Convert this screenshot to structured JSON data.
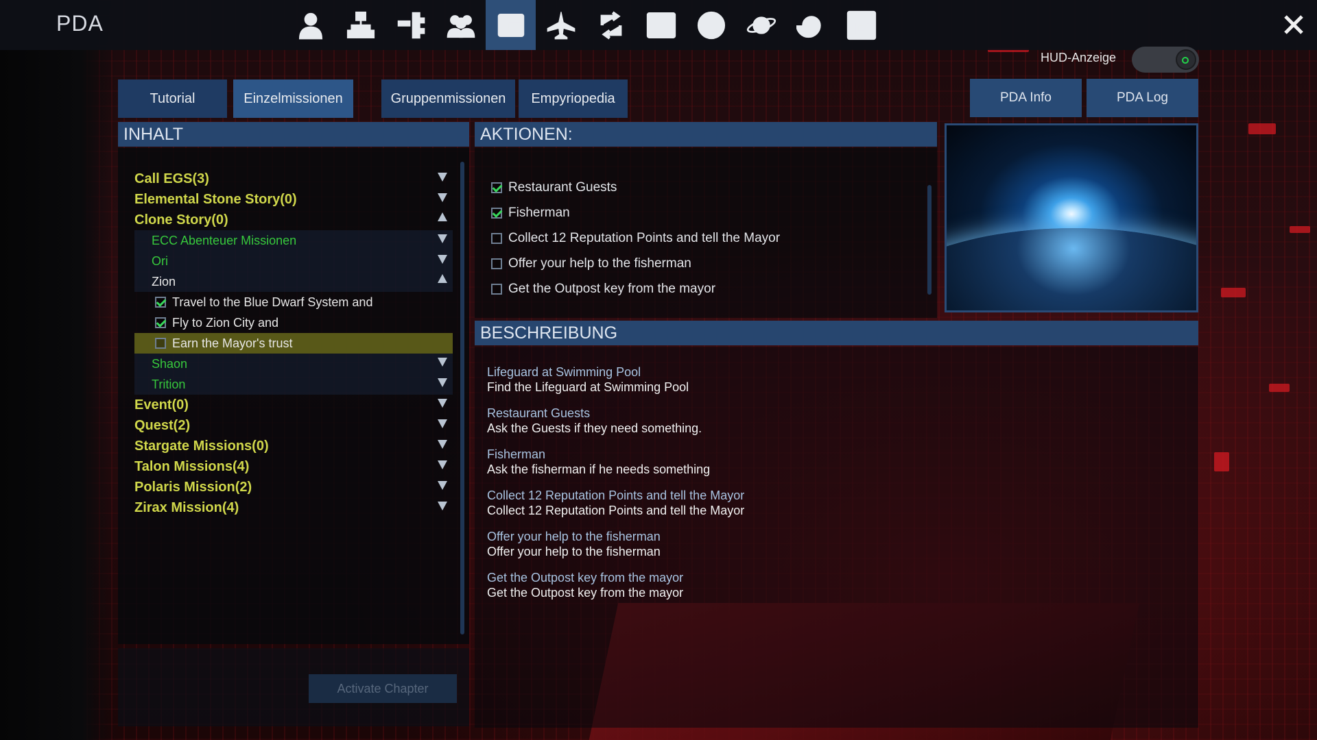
{
  "app": {
    "title": "PDA"
  },
  "nav": [
    {
      "icon": "player-icon"
    },
    {
      "icon": "network-icon"
    },
    {
      "icon": "structure-icon"
    },
    {
      "icon": "faction-icon"
    },
    {
      "icon": "pda-icon",
      "active": true
    },
    {
      "icon": "ship-icon"
    },
    {
      "icon": "trade-icon"
    },
    {
      "icon": "list-icon"
    },
    {
      "icon": "compass-icon"
    },
    {
      "icon": "planet-icon"
    },
    {
      "icon": "galaxy-icon"
    },
    {
      "icon": "settings-icon"
    }
  ],
  "hud": {
    "label": "HUD-Anzeige",
    "enabled": true
  },
  "tabs": {
    "tutorial": "Tutorial",
    "single": "Einzelmissionen",
    "group": "Gruppenmissionen",
    "empyriopedia": "Empyriopedia",
    "pda_info": "PDA Info",
    "pda_log": "PDA Log"
  },
  "headers": {
    "contents": "INHALT",
    "actions": "AKTIONEN:",
    "description": "BESCHREIBUNG"
  },
  "tree": {
    "call_egs": "Call EGS(3)",
    "elemental": "Elemental Stone Story(0)",
    "clone": "Clone Story(0)",
    "ecc": "ECC Abenteuer Missionen",
    "ori": "Ori",
    "zion": "Zion",
    "task1": "Travel to the Blue Dwarf System and",
    "task2": "Fly to Zion City and",
    "task3": "Earn the Mayor's trust",
    "shaon": "Shaon",
    "trition": "Trition",
    "event": "Event(0)",
    "quest": "Quest(2)",
    "stargate": "Stargate Missions(0)",
    "talon": "Talon Missions(4)",
    "polaris": "Polaris Mission(2)",
    "zirax": "Zirax Mission(4)"
  },
  "activate_label": "Activate Chapter",
  "actions": [
    {
      "label": "Restaurant Guests",
      "checked": true
    },
    {
      "label": "Fisherman",
      "checked": true
    },
    {
      "label": "Collect 12 Reputation Points and tell the Mayor",
      "checked": false
    },
    {
      "label": "Offer your help to the fisherman",
      "checked": false
    },
    {
      "label": "Get the Outpost key from the mayor",
      "checked": false
    }
  ],
  "description": [
    {
      "title": "Lifeguard at Swimming Pool",
      "text": "Find the Lifeguard at Swimming Pool"
    },
    {
      "title": "Restaurant Guests",
      "text": "Ask the Guests if they need something."
    },
    {
      "title": "Fisherman",
      "text": "Ask the fisherman if he needs something"
    },
    {
      "title": "Collect 12 Reputation Points and tell the Mayor",
      "text": "Collect 12 Reputation Points and tell the Mayor"
    },
    {
      "title": "Offer your help to the fisherman",
      "text": "Offer your help to the fisherman"
    },
    {
      "title": "Get the Outpost key from the mayor",
      "text": "Get the Outpost key from the mayor"
    }
  ]
}
